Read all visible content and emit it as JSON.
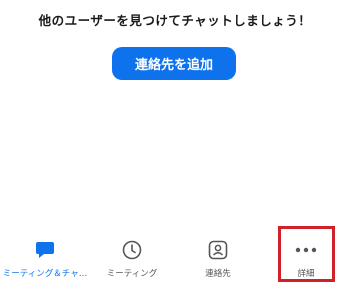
{
  "prompt_text": "他のユーザーを見つけてチャットしましょう！",
  "add_contact_button": "連絡先を追加",
  "tabs": [
    {
      "label": "ミーティング＆チャ…",
      "icon": "chat-bubble-icon",
      "active": true
    },
    {
      "label": "ミーティング",
      "icon": "clock-icon",
      "active": false
    },
    {
      "label": "連絡先",
      "icon": "contact-card-icon",
      "active": false
    },
    {
      "label": "詳細",
      "icon": "more-dots-icon",
      "active": false
    }
  ],
  "colors": {
    "accent": "#0e72ed",
    "highlight": "#d0212a",
    "inactive_icon": "#555555"
  }
}
